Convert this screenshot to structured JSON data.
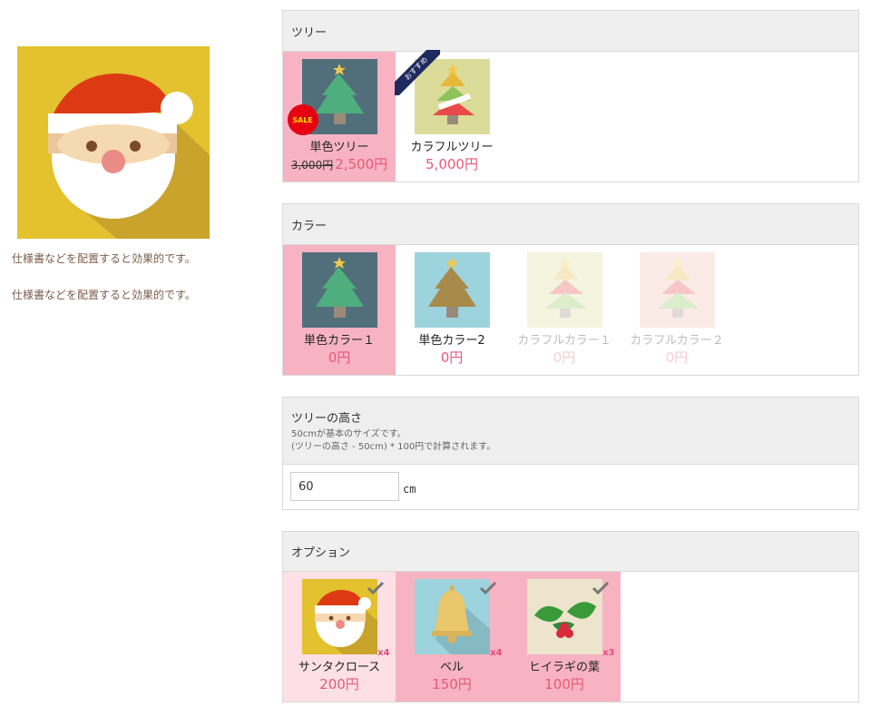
{
  "left": {
    "desc_1": "仕様書などを配置すると効果的です。",
    "desc_2": "仕様書などを配置すると効果的です。"
  },
  "tree_section": {
    "title": "ツリー",
    "items": [
      {
        "name": "単色ツリー",
        "old_price": "3,000円",
        "price": "2,500円",
        "badge": "SALE",
        "selected": true
      },
      {
        "name": "カラフルツリー",
        "price": "5,000円",
        "ribbon": "おすすめ",
        "selected": false
      }
    ]
  },
  "color_section": {
    "title": "カラー",
    "items": [
      {
        "name": "単色カラー１",
        "price": "0円",
        "selected": true
      },
      {
        "name": "単色カラー2",
        "price": "0円",
        "selected": false
      },
      {
        "name": "カラフルカラー１",
        "price": "0円",
        "disabled": true
      },
      {
        "name": "カラフルカラー２",
        "price": "0円",
        "disabled": true
      }
    ]
  },
  "height_section": {
    "title": "ツリーの高さ",
    "note_1": "50cmが基本のサイズです。",
    "note_2": "(ツリーの高さ - 50cm) * 100円で計算されます。",
    "value": "60",
    "unit": "cm"
  },
  "option_section": {
    "title": "オプション",
    "items": [
      {
        "name": "サンタクロース",
        "price": "200円",
        "qty": "x4"
      },
      {
        "name": "ベル",
        "price": "150円",
        "qty": "x4"
      },
      {
        "name": "ヒイラギの葉",
        "price": "100円",
        "qty": "x3"
      }
    ]
  },
  "colors": {
    "selected_bg": "#f7b3c2",
    "price": "#e65a78",
    "header_bg": "#efefef"
  }
}
